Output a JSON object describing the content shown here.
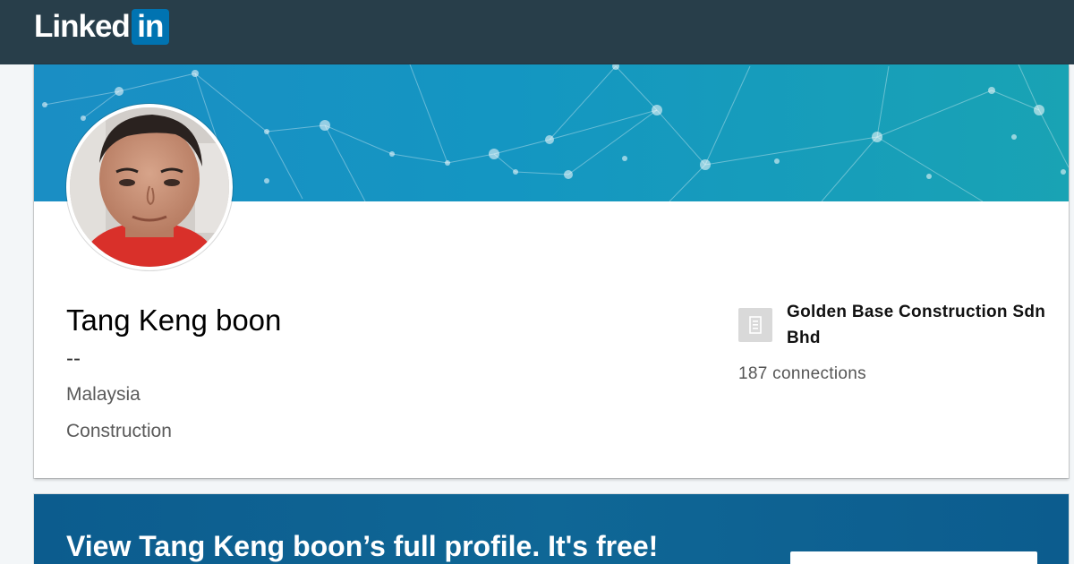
{
  "header": {
    "logo_text": "Linked",
    "logo_box_text": "in"
  },
  "profile": {
    "name": "Tang Keng boon",
    "headline": "--",
    "location": "Malaysia",
    "industry": "Construction",
    "company": "Golden Base Construction Sdn Bhd",
    "connections": "187 connections"
  },
  "cta": {
    "title": "View Tang Keng boon’s full profile. It's free!"
  },
  "colors": {
    "topbar": "#283e4a",
    "brand_blue": "#0073b1",
    "cta_background": "#0c5c8e"
  }
}
